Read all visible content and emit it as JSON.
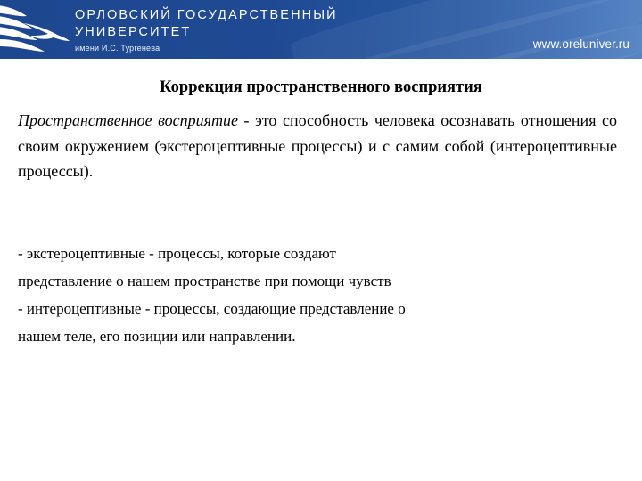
{
  "header": {
    "logo_icon": "university-bird-logo",
    "wordmark_line1": "ОРЛОВСКИЙ ГОСУДАРСТВЕННЫЙ",
    "wordmark_line2": "УНИВЕРСИТЕТ",
    "wordmark_line3": "имени И.С. Тургенева",
    "site_url": "www.oreluniver.ru",
    "background_color": "#1f4a91",
    "accent_color": "#4a7cc0",
    "text_color": "#ffffff"
  },
  "slide": {
    "title": "Коррекция пространственного восприятия",
    "paragraph_intro": {
      "emphasis": "Пространственное восприятие",
      "rest": " - это способность человека осознавать отношения со своим окружением (экстероцептивные процессы) и с самим собой (интероцептивные процессы)."
    },
    "bullets": [
      "- экстероцептивные - процессы, которые создают\nпредставление о нашем пространстве при помощи чувств",
      "- интероцептивные - процессы, создающие представление о\nнашем теле, его позиции или направлении."
    ],
    "background_color": "#ffffff",
    "text_color": "#000000"
  }
}
